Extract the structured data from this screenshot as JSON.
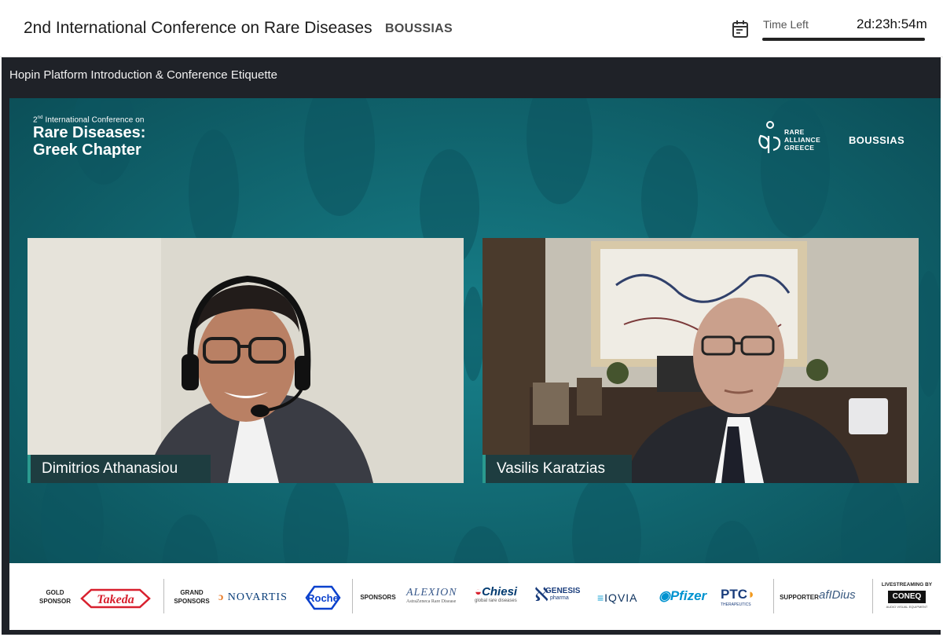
{
  "header": {
    "event_title": "2nd International Conference on Rare Diseases",
    "organizer": "BOUSSIAS",
    "timer_label": "Time Left",
    "timer_value": "2d:23h:54m",
    "calendar_icon": "calendar-icon"
  },
  "session": {
    "title": "Hopin Platform Introduction & Conference Etiquette"
  },
  "slide": {
    "conf_line1": "International Conference on",
    "conf_prefix": "2",
    "conf_superscript": "nd",
    "conf_line2": "Rare Diseases:",
    "conf_line3": "Greek Chapter",
    "partner_line1": "RARE",
    "partner_line2": "ALLIANCE",
    "partner_line3": "GREECE",
    "organizer_logo": "BOUSSIAS",
    "background_color": "#10606a"
  },
  "participants": [
    {
      "name": "Dimitrios Athanasiou"
    },
    {
      "name": "Vasilis Karatzias"
    }
  ],
  "sponsors": {
    "gold_label_1": "GOLD",
    "gold_label_2": "SPONSOR",
    "gold": "Takeda",
    "grand_label_1": "GRAND",
    "grand_label_2": "SPONSORS",
    "grand": [
      "NOVARTIS",
      "Roche"
    ],
    "sponsors_label": "SPONSORS",
    "alexion": "ALEXION",
    "alexion_sub": "AstraZeneca Rare Disease",
    "chiesi": "Chiesi",
    "chiesi_sub": "global rare diseases",
    "genesis": "GENESIS",
    "genesis_sub": "pharma",
    "iqvia": "IQVIA",
    "pfizer": "Pfizer",
    "ptc": "PTC",
    "ptc_sub": "THERAPEUTICS",
    "supporter_label": "SUPPORTER",
    "supporter": "afIDius",
    "livestream_label": "LIVESTREAMING BY",
    "livestream": "CONEQ",
    "livestream_sub": "AUDIO VISUAL EQUIPMENT"
  }
}
